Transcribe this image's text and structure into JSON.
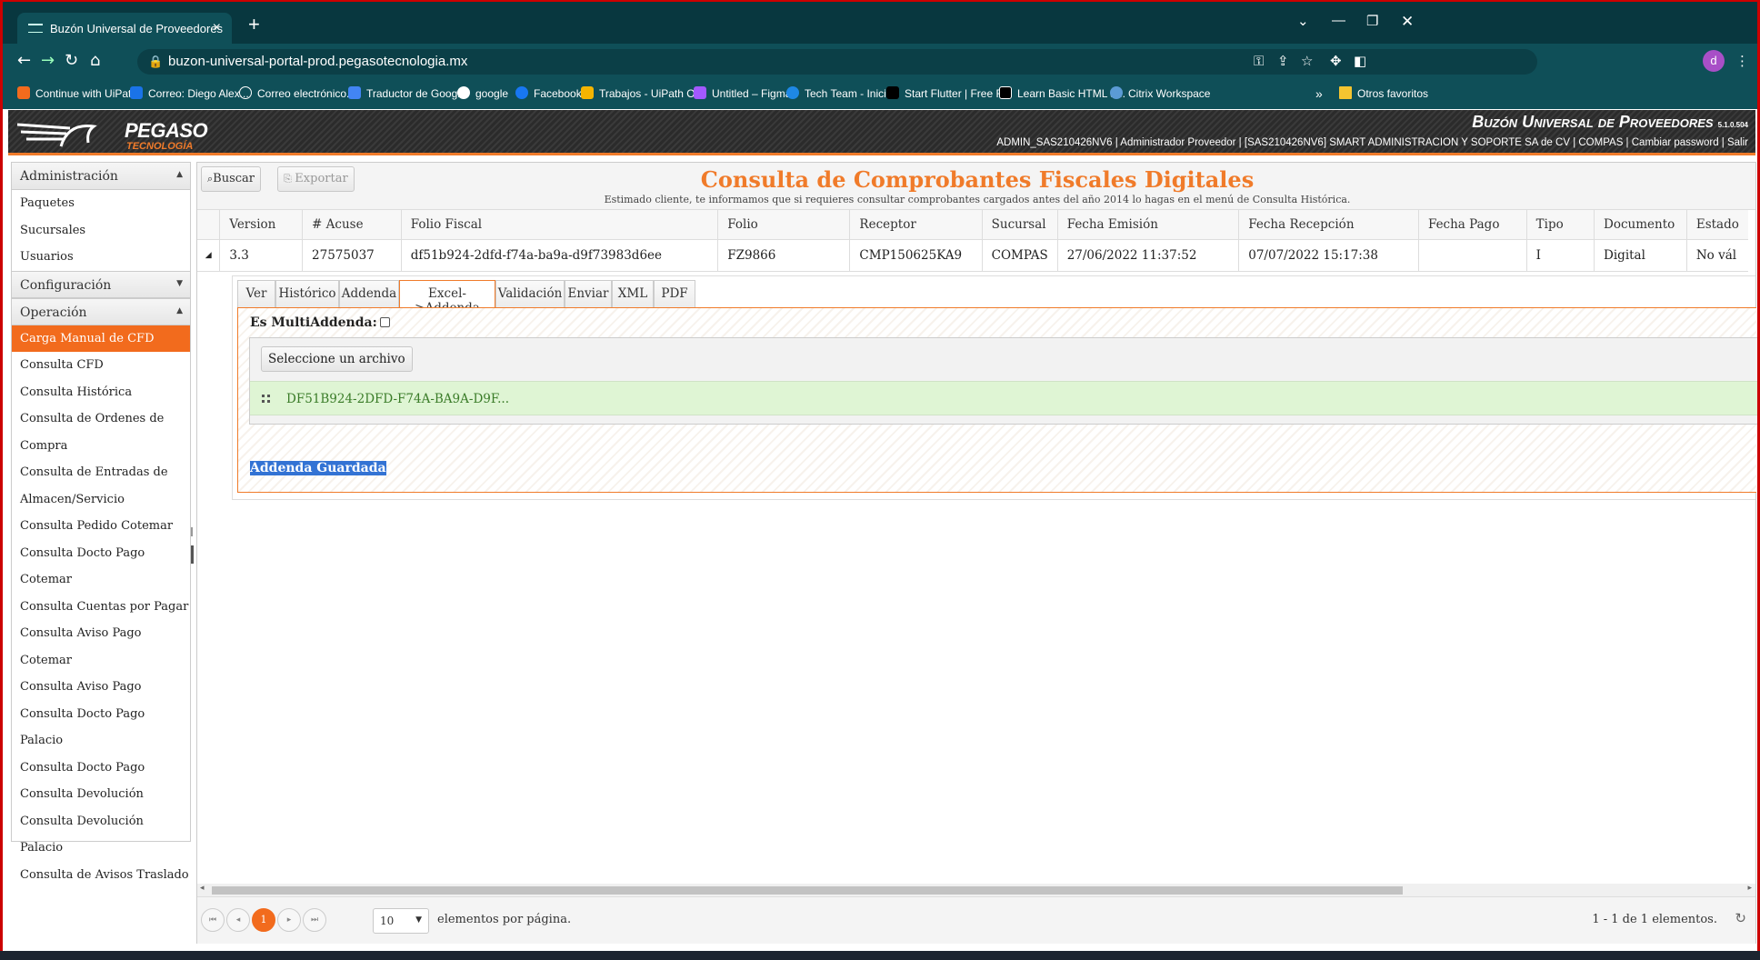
{
  "browser": {
    "tab_title": "Buzón Universal de Proveedores",
    "url": "buzon-universal-portal-prod.pegasotecnologia.mx",
    "profile_initial": "d",
    "bookmarks": [
      {
        "label": "Continue with UiPath",
        "color": "#f26b1d"
      },
      {
        "label": "Correo: Diego Alex...",
        "color": "#1a73e8"
      },
      {
        "label": "Correo electrónico...",
        "color": "#0f4f58"
      },
      {
        "label": "Traductor de Google",
        "color": "#4285f4"
      },
      {
        "label": "google",
        "color": "#ffffff"
      },
      {
        "label": "Facebook",
        "color": "#1877f2"
      },
      {
        "label": "Trabajos - UiPath O...",
        "color": "#f4b400"
      },
      {
        "label": "Untitled – Figma",
        "color": "#a259ff"
      },
      {
        "label": "Tech Team - Inicio",
        "color": "#1e88e5"
      },
      {
        "label": "Start Flutter | Free F...",
        "color": "#000000"
      },
      {
        "label": "Learn Basic HTML a...",
        "color": "#000000"
      },
      {
        "label": "Citrix Workspace",
        "color": "#5b9bd5"
      }
    ],
    "more_bookmarks": "»",
    "other_favorites": "Otros favoritos"
  },
  "header": {
    "logo_main": "PEGASO",
    "logo_sub": "TECNOLOGÍA",
    "system_title": "Buzón Universal de Proveedores",
    "version": "5.1.0.504",
    "user_bar": "ADMIN_SAS210426NV6 |  Administrador Proveedor |  [SAS210426NV6] SMART ADMINISTRACION Y SOPORTE SA de CV |  COMPAS  |  Cambiar password  |  Salir"
  },
  "sidebar": {
    "sections": [
      {
        "title": "Administración",
        "arrow": "▲",
        "items": [
          "Paquetes",
          "Sucursales",
          "Usuarios"
        ]
      },
      {
        "title": "Configuración",
        "arrow": "▼",
        "items": []
      },
      {
        "title": "Operación",
        "arrow": "▲",
        "items": [
          "Carga Manual de CFD",
          "Consulta CFD",
          "Consulta Histórica",
          "Consulta de Ordenes de",
          "Compra",
          "Consulta de Entradas de",
          "Almacen/Servicio",
          "Consulta Pedido Cotemar",
          "Consulta Docto Pago",
          "Cotemar",
          "Consulta Cuentas por Pagar",
          "Consulta Aviso Pago",
          "Cotemar",
          "Consulta Aviso Pago",
          "Consulta Docto Pago Palacio",
          "Consulta Docto Pago",
          "Consulta Devolución",
          "Consulta Devolución Palacio",
          "Consulta de Avisos Traslado"
        ]
      }
    ],
    "active_item": "Carga Manual de CFD"
  },
  "toolbar": {
    "search_label": "Buscar",
    "export_label": "Exportar"
  },
  "page": {
    "title": "Consulta de Comprobantes Fiscales Digitales",
    "note": "Estimado cliente, te informamos que si requieres consultar comprobantes cargados antes del año 2014 lo hagas en el menú de Consulta Histórica."
  },
  "grid": {
    "columns": [
      "Version",
      "# Acuse",
      "Folio Fiscal",
      "Folio",
      "Receptor",
      "Sucursal",
      "Fecha Emisión",
      "Fecha Recepción",
      "Fecha Pago",
      "Tipo",
      "Documento",
      "Estado"
    ],
    "rows": [
      [
        "3.3",
        "27575037",
        "df51b924-2dfd-f74a-ba9a-d9f73983d6ee",
        "FZ9866",
        "CMP150625KA9",
        "COMPAS",
        "27/06/2022 11:37:52",
        "07/07/2022 15:17:38",
        "",
        "I",
        "Digital",
        "No vál"
      ]
    ]
  },
  "detail": {
    "tabs": [
      "Ver",
      "Histórico",
      "Addenda",
      "Excel->Addenda",
      "Validación",
      "Enviar",
      "XML",
      "PDF"
    ],
    "active_tab": "Excel->Addenda",
    "multiaddenda_label": "Es MultiAddenda:",
    "multiaddenda_checked": false,
    "select_file_label": "Seleccione un archivo",
    "file_name": "DF51B924-2DFD-F74A-BA9A-D9F...",
    "status_message": "Addenda Guardada"
  },
  "pager": {
    "current_page": "1",
    "page_size": "10",
    "page_size_label": "elementos por página.",
    "info": "1 - 1 de 1 elementos."
  },
  "colors": {
    "accent": "#f07b2a",
    "active": "#f26b1d",
    "browser": "#0f4f58"
  }
}
